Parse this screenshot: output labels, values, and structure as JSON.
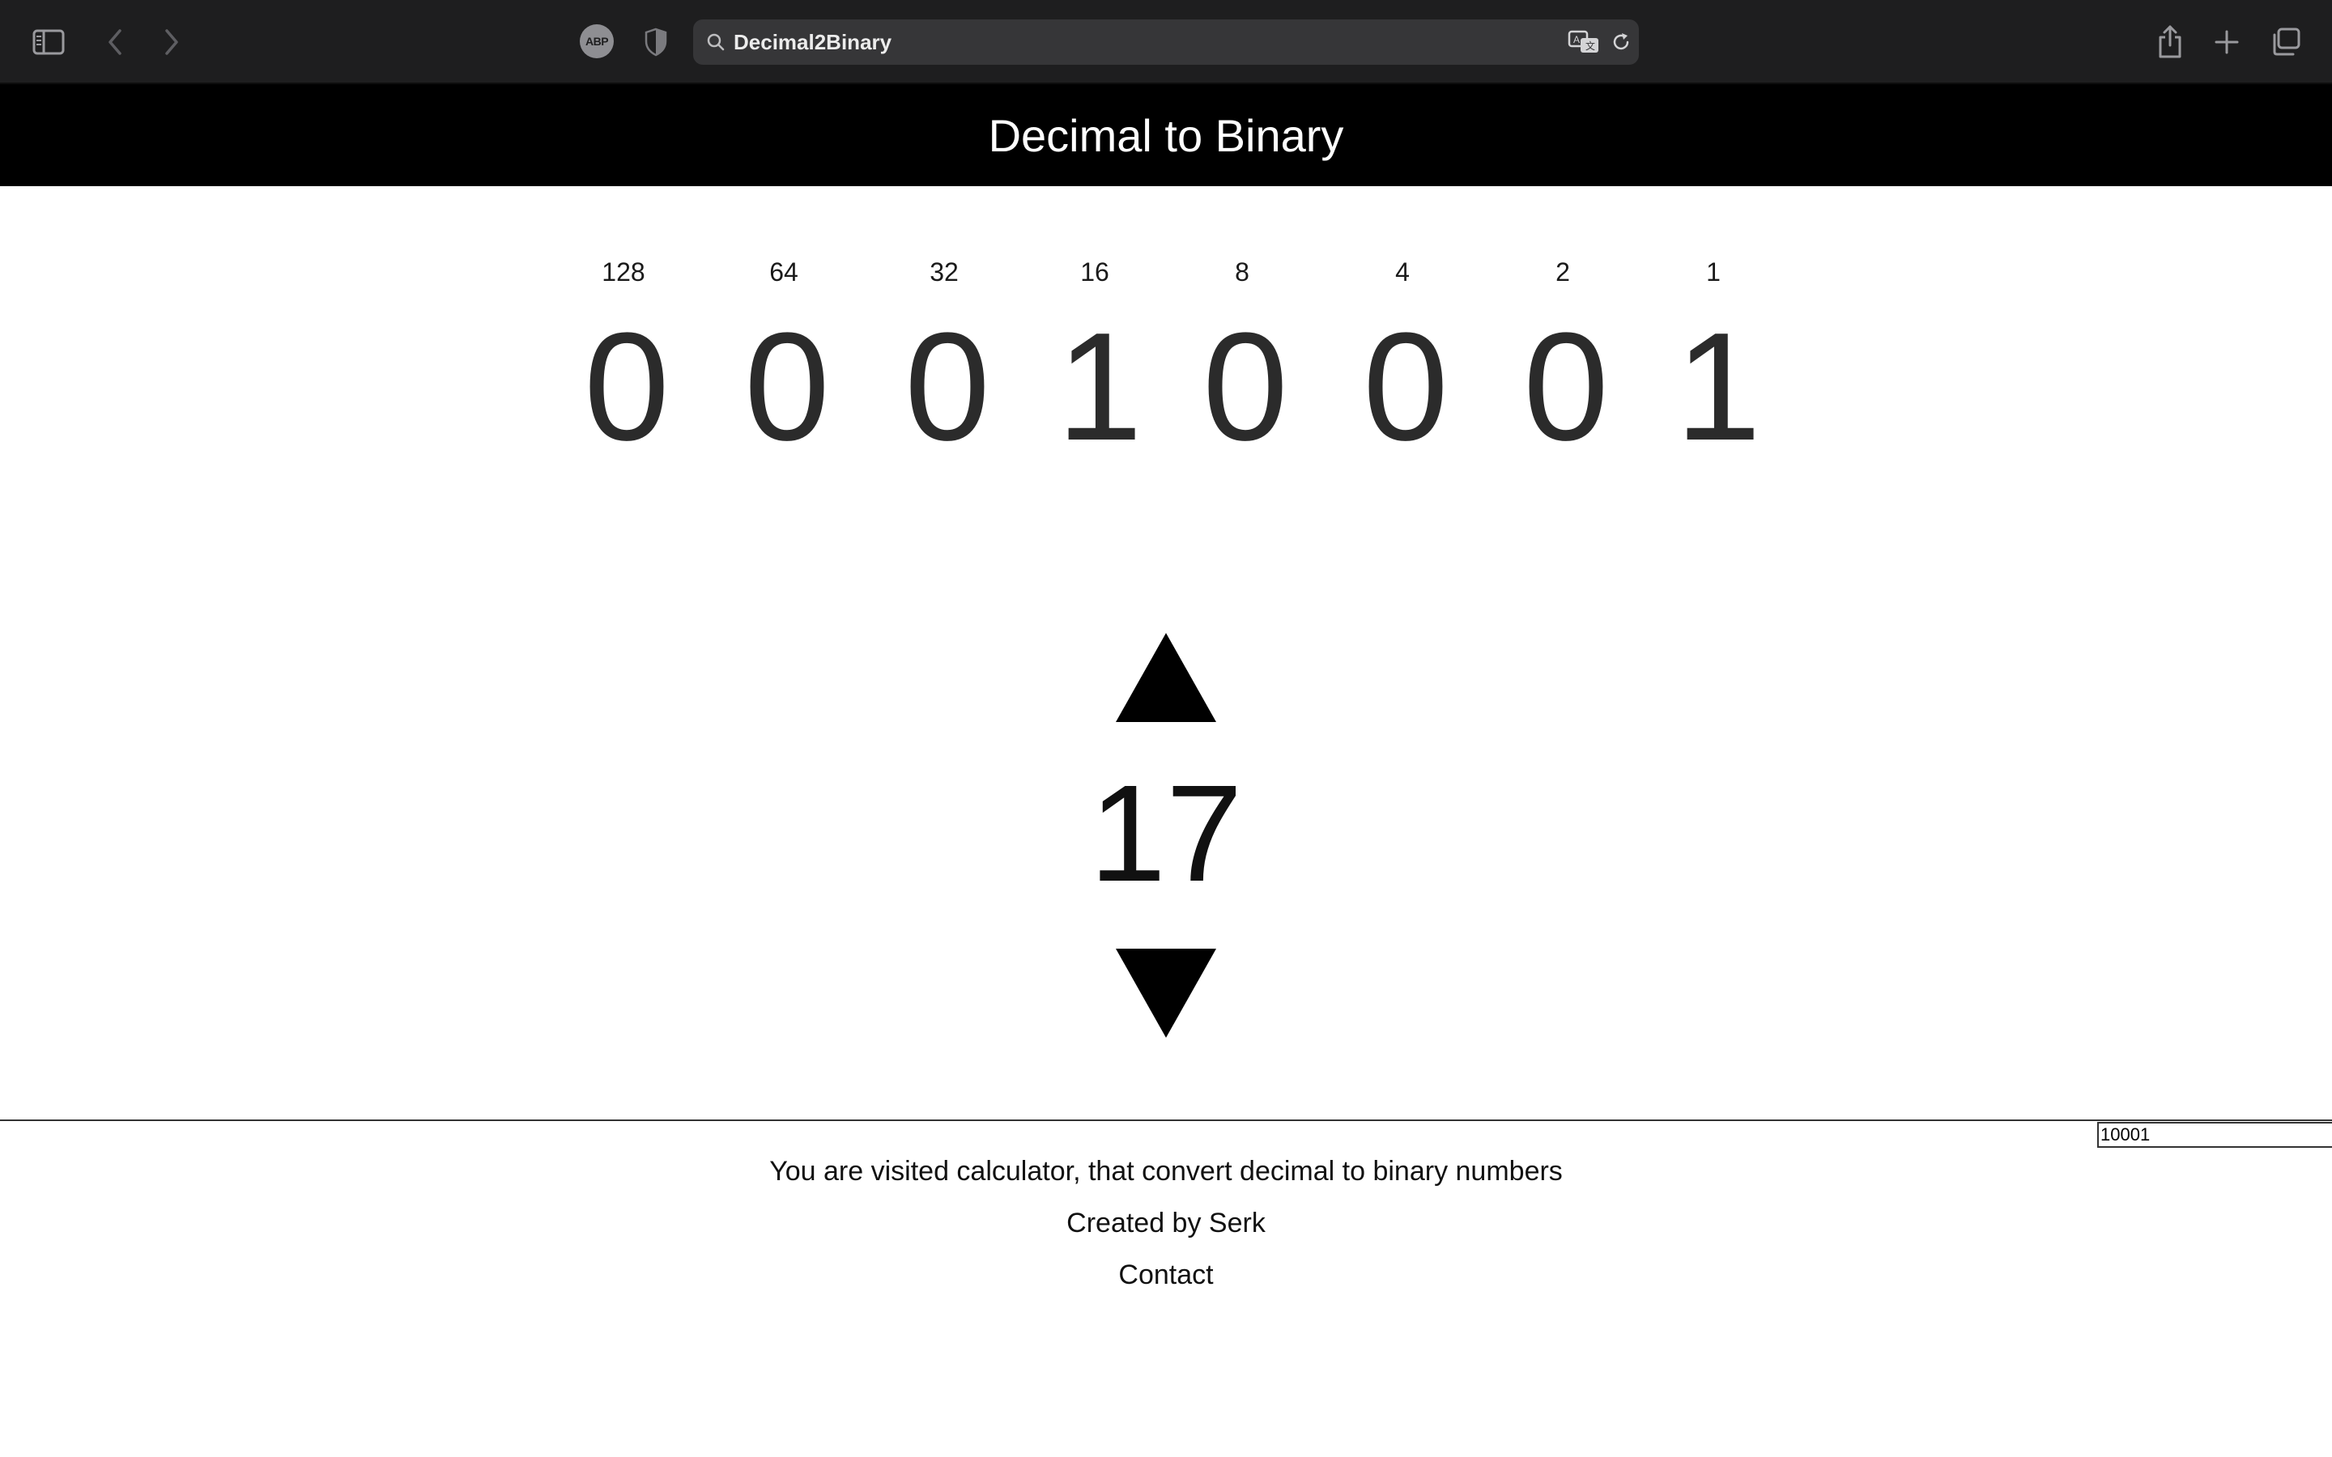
{
  "browser": {
    "address_text": "Decimal2Binary",
    "adblock_badge": "ABP",
    "icons": [
      "sidebar-icon",
      "back-icon",
      "forward-icon",
      "adblock-icon",
      "privacy-shield-icon",
      "search-icon",
      "translate-icon",
      "reload-icon",
      "share-icon",
      "new-tab-icon",
      "tab-overview-icon"
    ]
  },
  "header": {
    "title": "Decimal to Binary"
  },
  "bits": [
    {
      "weight": "128",
      "value": "0"
    },
    {
      "weight": "64",
      "value": "0"
    },
    {
      "weight": "32",
      "value": "0"
    },
    {
      "weight": "16",
      "value": "1"
    },
    {
      "weight": "8",
      "value": "0"
    },
    {
      "weight": "4",
      "value": "0"
    },
    {
      "weight": "2",
      "value": "0"
    },
    {
      "weight": "1",
      "value": "1"
    }
  ],
  "controls": {
    "decimal_value": "17",
    "increment_icon": "triangle-up-icon",
    "decrement_icon": "triangle-down-icon"
  },
  "binary_field": {
    "value": "10001"
  },
  "footer": {
    "description": "You are visited calculator, that convert decimal to binary numbers",
    "credit": "Created by Serk",
    "contact": "Contact"
  }
}
